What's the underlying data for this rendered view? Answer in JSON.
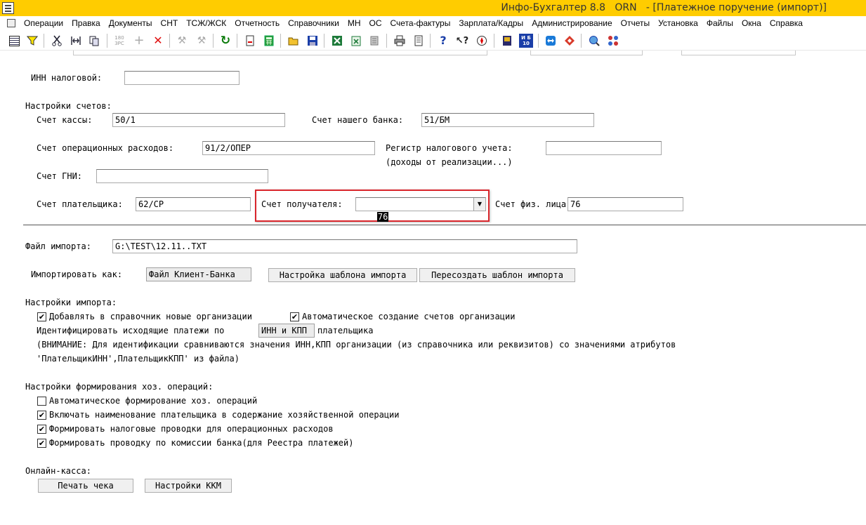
{
  "window": {
    "title": "Инфо-Бухгалтер 8.8   ORN   - [Платежное поручение (импорт)]"
  },
  "menu": [
    "Операции",
    "Правка",
    "Документы",
    "СНТ",
    "ТСЖ/ЖСК",
    "Отчетность",
    "Справочники",
    "МН",
    "ОС",
    "Счета-фактуры",
    "Зарплата/Кадры",
    "Администрирование",
    "Отчеты",
    "Установка",
    "Файлы",
    "Окна",
    "Справка"
  ],
  "toolbar": {
    "calc_icon_text": "180\nЗРС",
    "ib_badge": "И Б\n10"
  },
  "form": {
    "inn_label": "ИНН налоговой:",
    "inn_value": "",
    "accounts_section": "Настройки счетов:",
    "cash_label": "Счет кассы:",
    "cash_value": "50/1",
    "bank_label": "Счет нашего банка:",
    "bank_value": "51/БМ",
    "opex_label": "Счет операционных расходов:",
    "opex_value": "91/2/ОПЕР",
    "tax_reg_label": "Регистр налогового учета:",
    "tax_reg_label2": "(доходы от реализации...)",
    "tax_reg_value": "",
    "gni_label": "Счет ГНИ:",
    "gni_value": "",
    "payer_label": "Счет плательщика:",
    "payer_value": "62/СР",
    "recipient_label": "Счет получателя:",
    "recipient_value": "76",
    "person_label": "Счет физ. лица:",
    "person_value": "76",
    "import_file_label": "Файл импорта:",
    "import_file_value": "G:\\TEST\\12.11..TXT",
    "import_as_label": "Импортировать как:",
    "import_as_value": "Файл Клиент-Банка",
    "template_settings_btn": "Настройка шаблона импорта",
    "recreate_template_btn": "Пересоздать шаблон импорта",
    "import_settings_section": "Настройки импорта:",
    "add_orgs_label": "Добавлять в справочник новые организации",
    "add_orgs_checked": true,
    "auto_accounts_label": "Автоматическое создание счетов организации",
    "auto_accounts_checked": true,
    "identify_label": "Идентифицировать исходящие платежи по",
    "identify_value": "ИНН и КПП",
    "identify_suffix": "плательщика",
    "warning_line1": "(ВНИМАНИЕ: Для идентификации сравниваются значения ИНН,КПП организации (из справочника или реквизитов) со значениями атрибутов",
    "warning_line2": "'ПлательщикИНН',ПлательщикКПП' из файла)",
    "ops_section": "Настройки формирования хоз. операций:",
    "opt_auto_ops_label": "Автоматическое формирование хоз. операций",
    "opt_auto_ops_checked": false,
    "opt_payer_name_label": "Включать наименование плательщика в содержание хозяйственной операции",
    "opt_payer_name_checked": true,
    "opt_tax_entries_label": "Формировать налоговые проводки для операционных расходов",
    "opt_tax_entries_checked": true,
    "opt_bank_fee_label": "Формировать проводку по комиссии банка(для Реестра платежей)",
    "opt_bank_fee_checked": true,
    "online_cash_section": "Онлайн-касса:",
    "print_receipt_btn": "Печать чека",
    "kkm_settings_btn": "Настройки ККМ"
  },
  "colors": {
    "titlebar": "#ffcc00",
    "highlight_box": "#d9262c"
  }
}
